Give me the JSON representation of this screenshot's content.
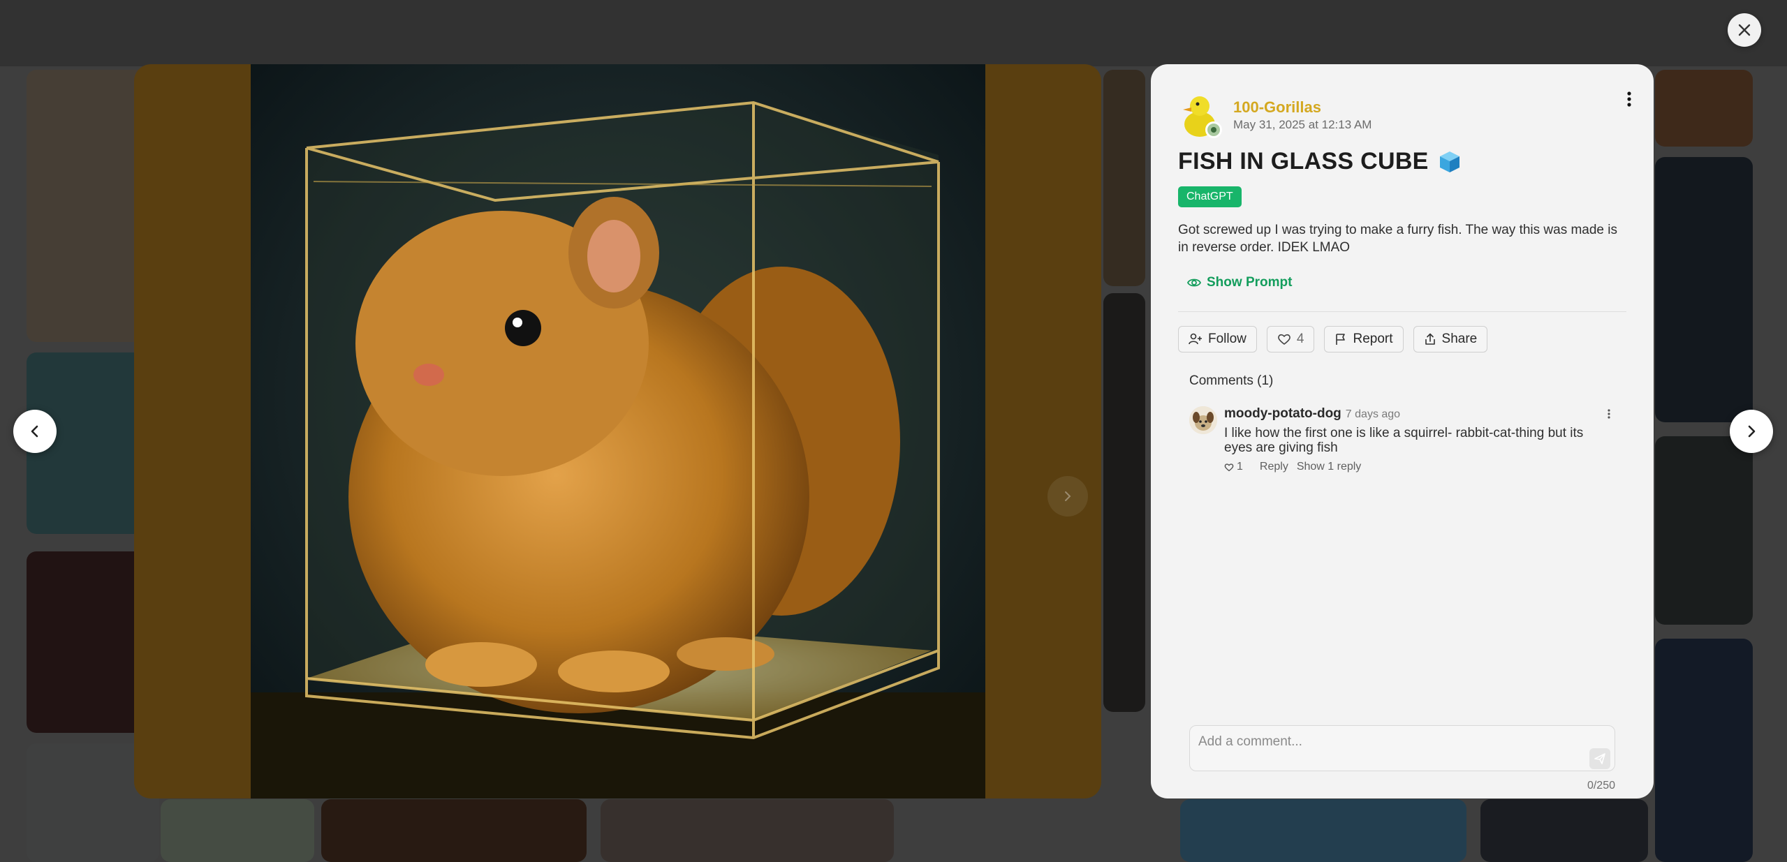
{
  "post": {
    "author": "100-Gorillas",
    "date": "May 31, 2025 at 12:13 AM",
    "title": "FISH IN GLASS CUBE",
    "title_emoji_icon": "blue-cube-icon",
    "model_badge": "ChatGPT",
    "description": "Got screwed up I was trying to make a furry fish. The way this was made is in reverse order. IDEK LMAO",
    "show_prompt_label": "Show Prompt"
  },
  "actions": {
    "follow_label": "Follow",
    "like_count": "4",
    "report_label": "Report",
    "share_label": "Share"
  },
  "comments": {
    "heading": "Comments (1)",
    "items": [
      {
        "user": "moody-potato-dog",
        "time": "7 days ago",
        "text": "I like how the first one is like a squirrel- rabbit-cat-thing but its eyes are giving fish",
        "likes": "1",
        "reply_label": "Reply",
        "show_replies_label": "Show 1 reply"
      }
    ]
  },
  "composer": {
    "placeholder": "Add a comment...",
    "char_count": "0/250"
  },
  "colors": {
    "author": "#d4a820",
    "badge": "#18b56a",
    "prompt_link": "#139d5c"
  }
}
